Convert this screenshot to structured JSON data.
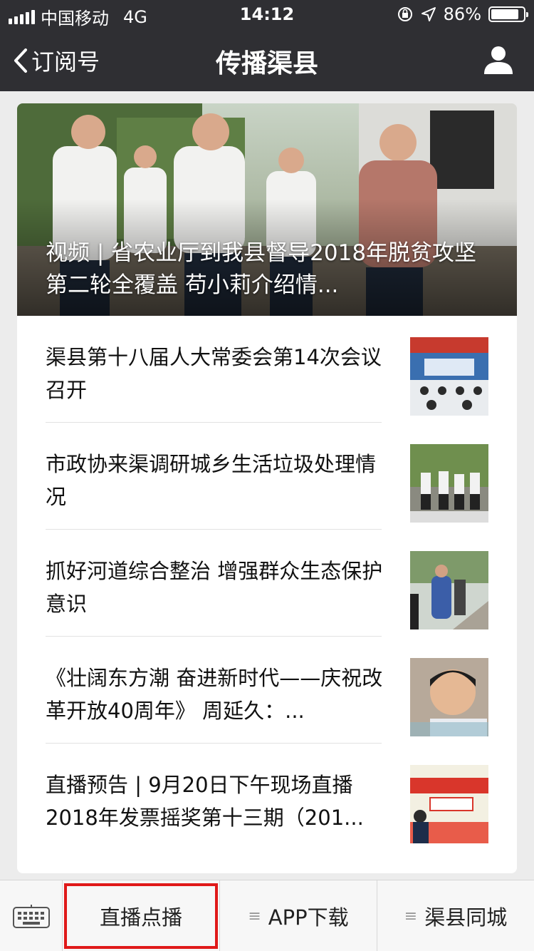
{
  "status": {
    "carrier": "中国移动",
    "network": "4G",
    "time": "14:12",
    "battery": "86%",
    "battery_level": 0.86
  },
  "nav": {
    "back_label": "订阅号",
    "title": "传播渠县"
  },
  "hero": {
    "title": "视频 | 省农业厅到我县督导2018年脱贫攻坚第二轮全覆盖 苟小莉介绍情..."
  },
  "articles": [
    {
      "title": "渠县第十八届人大常委会第14次会议召开"
    },
    {
      "title": "市政协来渠调研城乡生活垃圾处理情况"
    },
    {
      "title": "抓好河道综合整治 增强群众生态保护意识"
    },
    {
      "title": "《壮阔东方潮 奋进新时代——庆祝改革开放40周年》 周延久：..."
    },
    {
      "title": "直播预告 | 9月20日下午现场直播2018年发票摇奖第十三期（201..."
    }
  ],
  "bottom_menu": {
    "item1": "直播点播",
    "item2": "APP下载",
    "item3": "渠县同城"
  },
  "colors": {
    "nav_bg": "#2f2f33",
    "highlight": "#e01919"
  }
}
